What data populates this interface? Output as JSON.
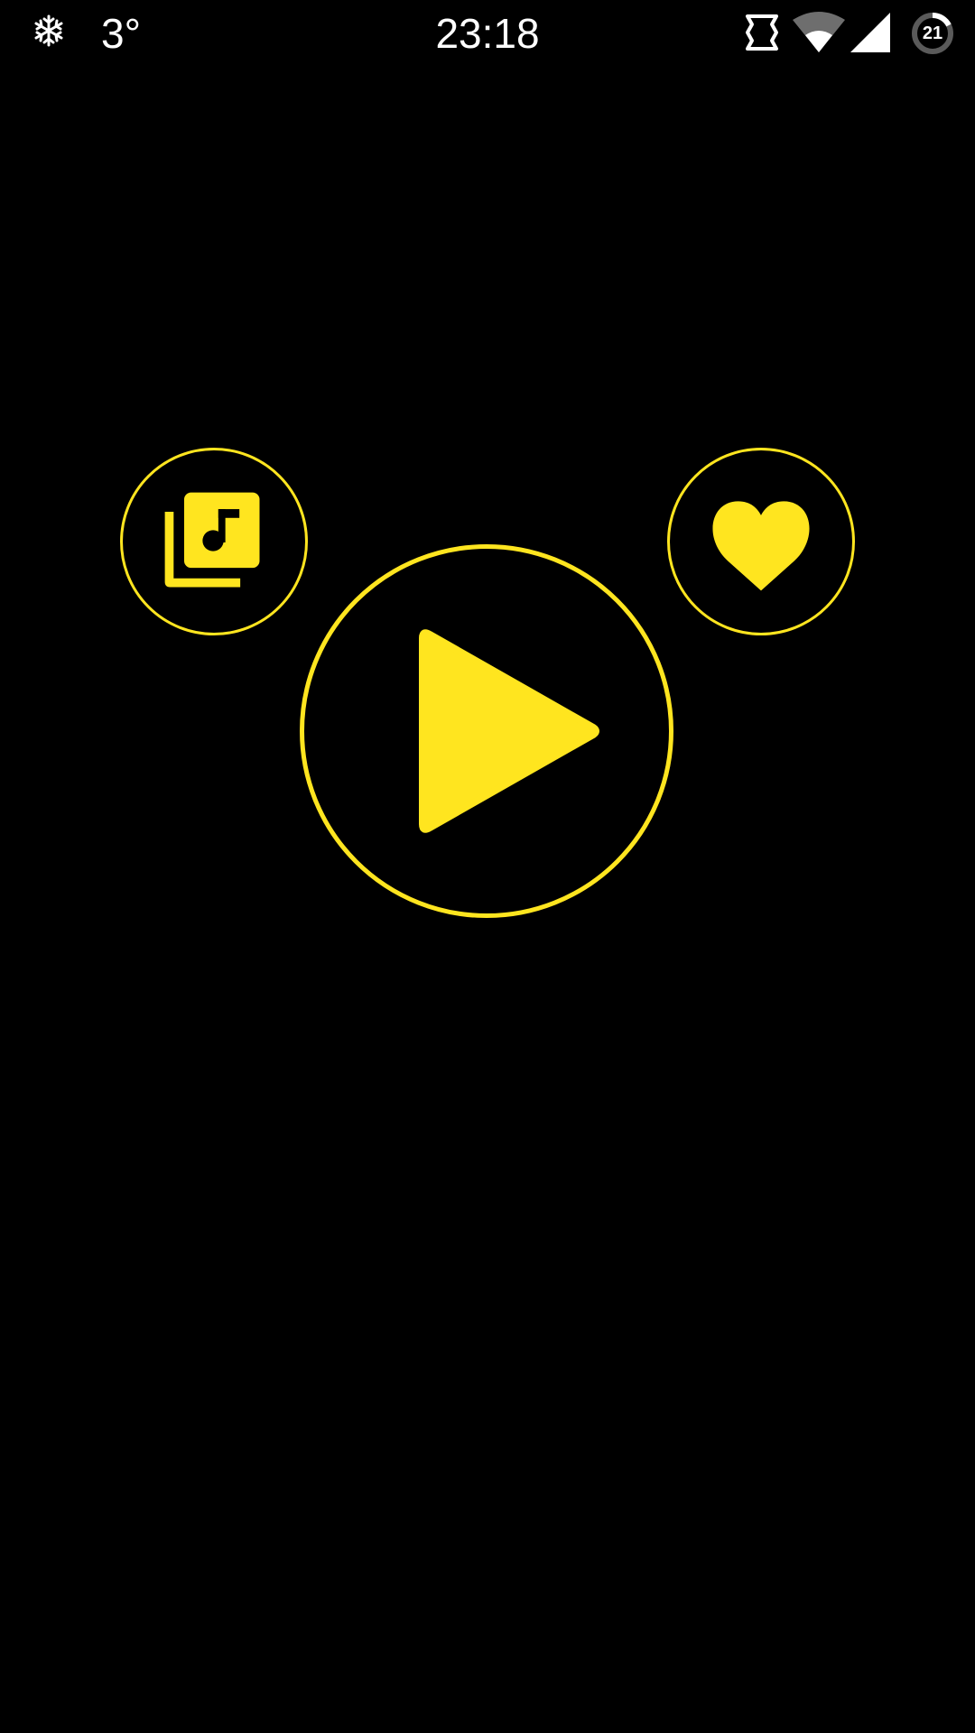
{
  "status_bar": {
    "weather_icon": "snowflake-icon",
    "temperature": "3°",
    "time": "23:18",
    "data_icon": "data-transfer-icon",
    "wifi_icon": "wifi-icon",
    "signal_icon": "cell-signal-icon",
    "battery_level": "21"
  },
  "player": {
    "library_icon": "music-library-icon",
    "play_icon": "play-icon",
    "favorite_icon": "heart-icon"
  },
  "colors": {
    "accent": "#ffe51f",
    "background": "#000000",
    "status_text": "#ffffff"
  }
}
